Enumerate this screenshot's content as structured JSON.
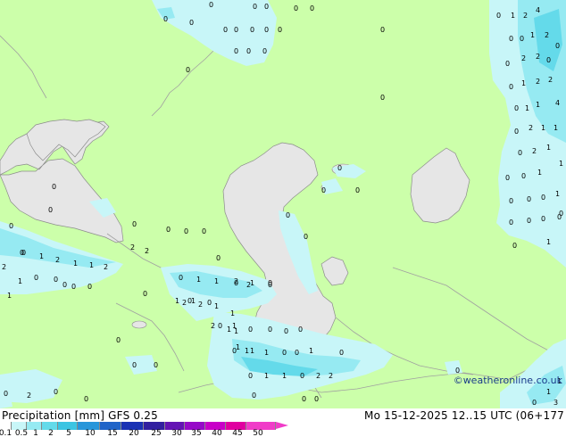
{
  "header": {
    "title_left": "Precipitation [mm]  GFS 0.25",
    "title_right": "Mo 15-12-2025 12..15 UTC (06+177",
    "credit": "©weatheronline.co.uk"
  },
  "legend": {
    "ticks": [
      "0.1",
      "0.5",
      "1",
      "2",
      "5",
      "10",
      "15",
      "20",
      "25",
      "30",
      "35",
      "40",
      "45",
      "50"
    ],
    "colors": [
      "#ffffff",
      "#c8f6f8",
      "#96eaf2",
      "#64daea",
      "#3cc4e2",
      "#2896da",
      "#2064c8",
      "#1a32b4",
      "#3220a0",
      "#6414b4",
      "#960ac8",
      "#c800c8",
      "#e000a0",
      "#f03cc8"
    ]
  },
  "map": {
    "land_color": "#ccffaa",
    "sea_color": "#e6e6e6",
    "precip_light": "#c8f6f8",
    "precip_medium": "#96eaf2",
    "precip_heavy": "#64daea",
    "border_color": "#a0a0a0"
  },
  "labels": [
    {
      "t": "0"
    },
    {
      "t": "0"
    },
    {
      "t": "0"
    },
    {
      "t": "0"
    },
    {
      "t": "0"
    },
    {
      "t": "0"
    },
    {
      "t": "0"
    },
    {
      "t": "0"
    },
    {
      "t": "0"
    },
    {
      "t": "0"
    },
    {
      "t": "0"
    },
    {
      "t": "0"
    },
    {
      "t": "0"
    },
    {
      "t": "0"
    },
    {
      "t": "0"
    },
    {
      "t": "0"
    },
    {
      "t": "0"
    },
    {
      "t": "0"
    },
    {
      "t": "1"
    },
    {
      "t": "2"
    },
    {
      "t": "4"
    },
    {
      "t": "0"
    },
    {
      "t": "0"
    },
    {
      "t": "1"
    },
    {
      "t": "2"
    },
    {
      "t": "0"
    },
    {
      "t": "0"
    },
    {
      "t": "2"
    },
    {
      "t": "2"
    },
    {
      "t": "0"
    },
    {
      "t": "0"
    },
    {
      "t": "1"
    },
    {
      "t": "2"
    },
    {
      "t": "2"
    },
    {
      "t": "0"
    },
    {
      "t": "1"
    },
    {
      "t": "1"
    },
    {
      "t": "4"
    },
    {
      "t": "0"
    },
    {
      "t": "2"
    },
    {
      "t": "1"
    },
    {
      "t": "1"
    },
    {
      "t": "0"
    },
    {
      "t": "2"
    },
    {
      "t": "1"
    },
    {
      "t": "0"
    },
    {
      "t": "0"
    },
    {
      "t": "1"
    },
    {
      "t": "1"
    },
    {
      "t": "0"
    },
    {
      "t": "0"
    },
    {
      "t": "0"
    },
    {
      "t": "1"
    },
    {
      "t": "0"
    },
    {
      "t": "0"
    },
    {
      "t": "0"
    },
    {
      "t": "0"
    },
    {
      "t": "0"
    },
    {
      "t": "0"
    },
    {
      "t": "1"
    },
    {
      "t": "0"
    },
    {
      "t": "0"
    },
    {
      "t": "0"
    },
    {
      "t": "0"
    },
    {
      "t": "0"
    },
    {
      "t": "0"
    },
    {
      "t": "0"
    },
    {
      "t": "0"
    },
    {
      "t": "0"
    },
    {
      "t": "0"
    },
    {
      "t": "0"
    },
    {
      "t": "0"
    },
    {
      "t": "0"
    },
    {
      "t": "0"
    },
    {
      "t": "0"
    },
    {
      "t": "0"
    },
    {
      "t": "0"
    },
    {
      "t": "0"
    },
    {
      "t": "0"
    },
    {
      "t": "0"
    },
    {
      "t": "0"
    },
    {
      "t": "0"
    },
    {
      "t": "0"
    },
    {
      "t": "0"
    },
    {
      "t": "0"
    },
    {
      "t": "0"
    },
    {
      "t": "1"
    },
    {
      "t": "2"
    },
    {
      "t": "1"
    },
    {
      "t": "1"
    },
    {
      "t": "2"
    },
    {
      "t": "2"
    },
    {
      "t": "2"
    },
    {
      "t": "2"
    },
    {
      "t": "1"
    },
    {
      "t": "1"
    },
    {
      "t": "0"
    },
    {
      "t": "1"
    },
    {
      "t": "1"
    },
    {
      "t": "0"
    },
    {
      "t": "1"
    },
    {
      "t": "0"
    },
    {
      "t": "0"
    },
    {
      "t": "2"
    },
    {
      "t": "2"
    },
    {
      "t": "1"
    },
    {
      "t": "2"
    },
    {
      "t": "2"
    },
    {
      "t": "0"
    },
    {
      "t": "0"
    },
    {
      "t": "1"
    },
    {
      "t": "1"
    },
    {
      "t": "0"
    },
    {
      "t": "1"
    },
    {
      "t": "0"
    },
    {
      "t": "1"
    },
    {
      "t": "0"
    },
    {
      "t": "1"
    },
    {
      "t": "1"
    },
    {
      "t": "0"
    },
    {
      "t": "0"
    },
    {
      "t": "0"
    },
    {
      "t": "0"
    },
    {
      "t": "2"
    },
    {
      "t": "1"
    },
    {
      "t": "1"
    },
    {
      "t": "1"
    },
    {
      "t": "1"
    },
    {
      "t": "0"
    },
    {
      "t": "0"
    },
    {
      "t": "1"
    },
    {
      "t": "0"
    },
    {
      "t": "0"
    },
    {
      "t": "1"
    },
    {
      "t": "1"
    },
    {
      "t": "0"
    },
    {
      "t": "2"
    },
    {
      "t": "2"
    },
    {
      "t": "0"
    },
    {
      "t": "0"
    },
    {
      "t": "0"
    },
    {
      "t": "0"
    },
    {
      "t": "1"
    },
    {
      "t": "1"
    },
    {
      "t": "3"
    },
    {
      "t": "0"
    },
    {
      "t": "0"
    },
    {
      "t": "2"
    },
    {
      "t": "1"
    },
    {
      "t": "0"
    },
    {
      "t": "1"
    },
    {
      "t": "0"
    },
    {
      "t": "0"
    },
    {
      "t": "2"
    },
    {
      "t": "1"
    },
    {
      "t": "0"
    },
    {
      "t": "1"
    },
    {
      "t": "1"
    },
    {
      "t": "0"
    },
    {
      "t": "1"
    },
    {
      "t": "3"
    },
    {
      "t": "1"
    },
    {
      "t": "0"
    },
    {
      "t": "0"
    }
  ]
}
